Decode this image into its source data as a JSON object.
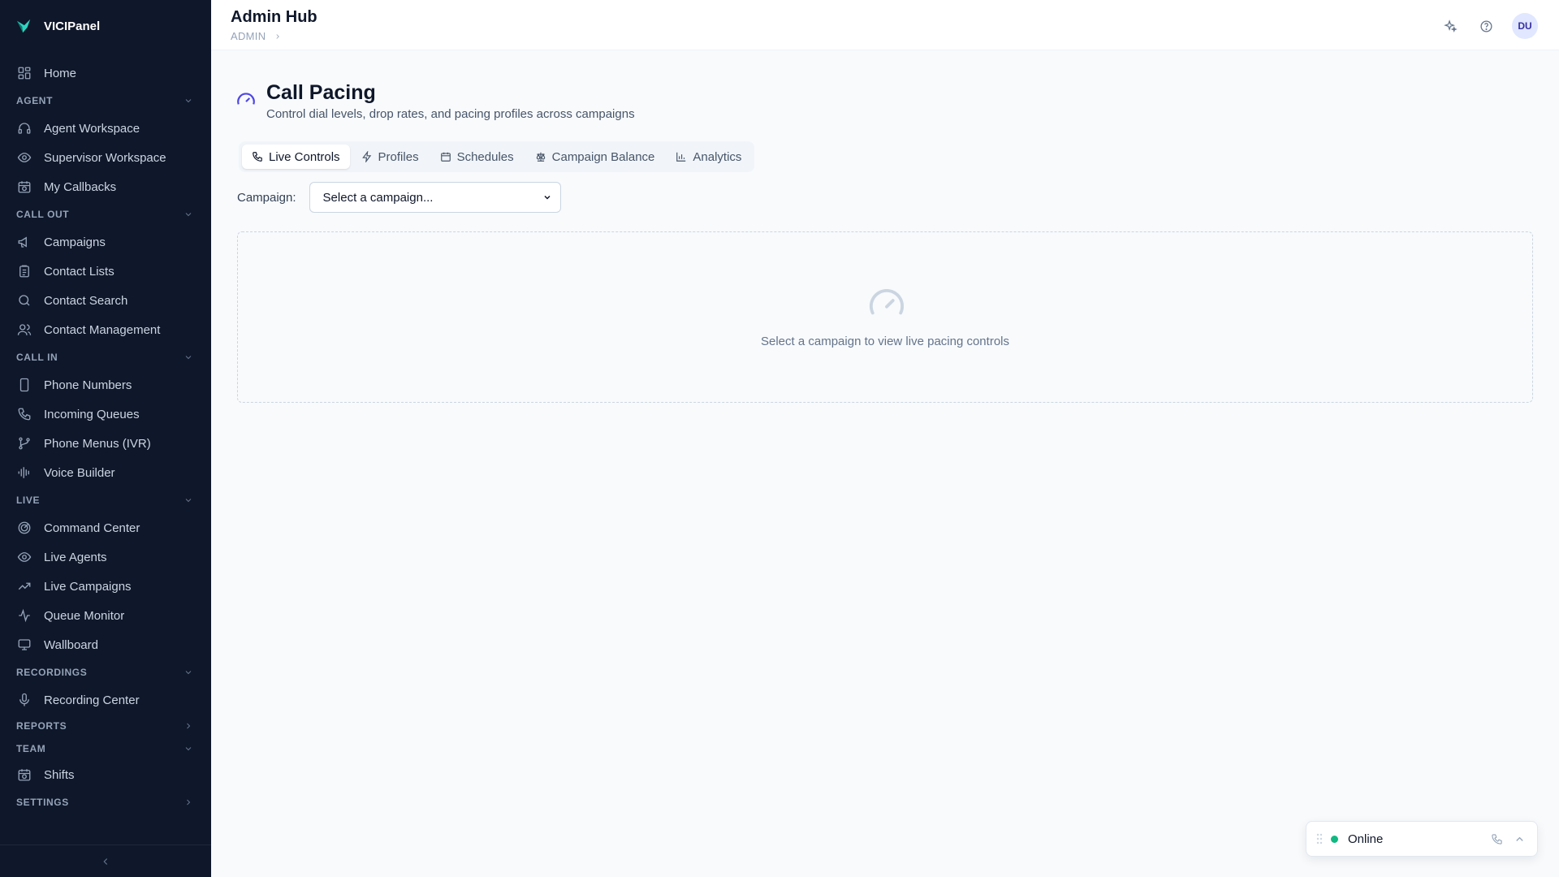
{
  "brand": {
    "name": "VICIPanel"
  },
  "header": {
    "title": "Admin Hub",
    "breadcrumb": "ADMIN",
    "avatar_initials": "DU"
  },
  "sidebar": {
    "home": "Home",
    "sections": {
      "agent": {
        "label": "AGENT",
        "items": [
          "Agent Workspace",
          "Supervisor Workspace",
          "My Callbacks"
        ]
      },
      "call_out": {
        "label": "CALL OUT",
        "items": [
          "Campaigns",
          "Contact Lists",
          "Contact Search",
          "Contact Management"
        ]
      },
      "call_in": {
        "label": "CALL IN",
        "items": [
          "Phone Numbers",
          "Incoming Queues",
          "Phone Menus (IVR)",
          "Voice Builder"
        ]
      },
      "live": {
        "label": "LIVE",
        "items": [
          "Command Center",
          "Live Agents",
          "Live Campaigns",
          "Queue Monitor",
          "Wallboard"
        ]
      },
      "recordings": {
        "label": "RECORDINGS",
        "items": [
          "Recording Center"
        ]
      },
      "reports": {
        "label": "REPORTS"
      },
      "team": {
        "label": "TEAM",
        "items": [
          "Shifts"
        ]
      },
      "settings": {
        "label": "SETTINGS"
      }
    }
  },
  "page": {
    "title": "Call Pacing",
    "subtitle": "Control dial levels, drop rates, and pacing profiles across campaigns",
    "tabs": [
      "Live Controls",
      "Profiles",
      "Schedules",
      "Campaign Balance",
      "Analytics"
    ],
    "active_tab": "Live Controls",
    "campaign_label": "Campaign:",
    "campaign_select_value": "Select a campaign...",
    "empty_message": "Select a campaign to view live pacing controls"
  },
  "status_widget": {
    "status": "Online",
    "status_color": "#10b981"
  },
  "colors": {
    "sidebar_bg": "#0f172a",
    "accent": "#4f46e5"
  }
}
